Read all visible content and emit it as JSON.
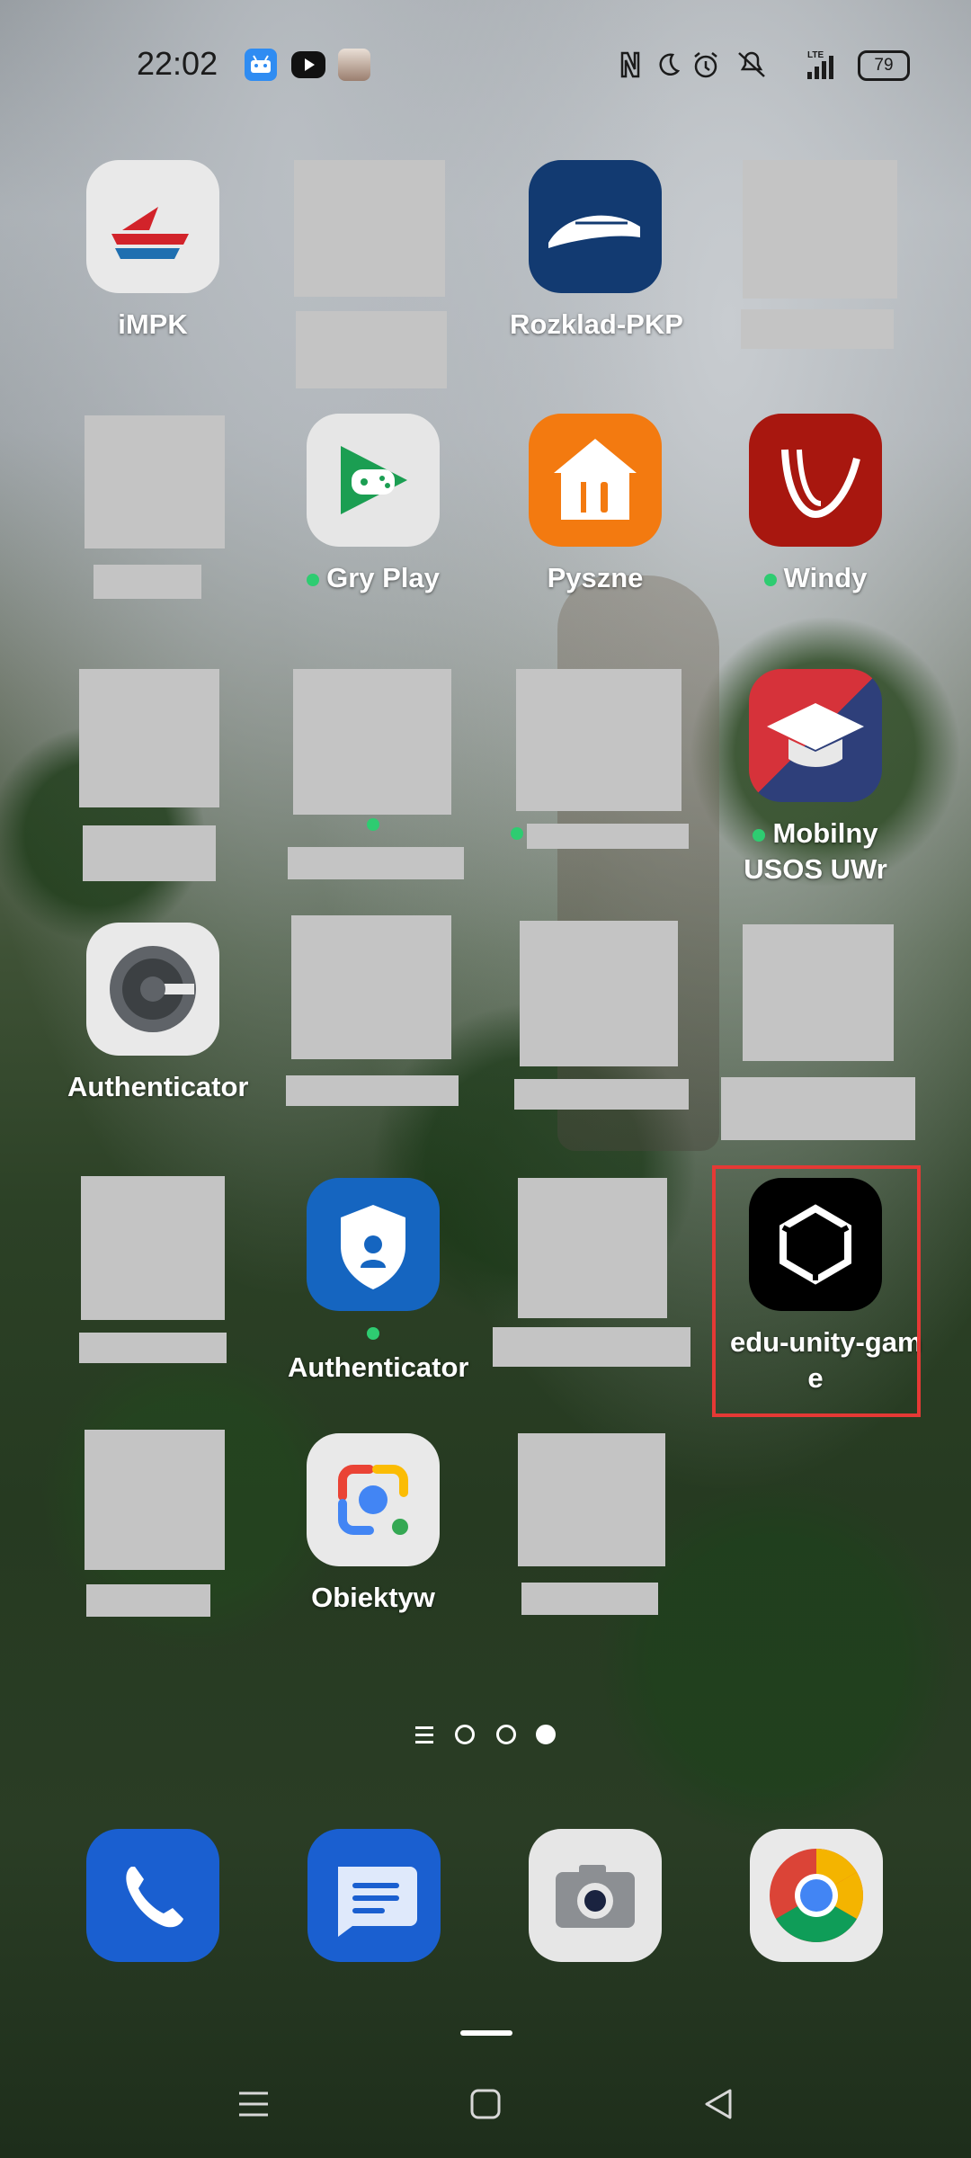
{
  "status_bar": {
    "time": "22:02",
    "notification_icons": [
      "android-icon",
      "youtube-icon",
      "avatar-icon"
    ],
    "system_icons": [
      "nfc-icon",
      "moon-icon",
      "alarm-icon",
      "mute-icon",
      "lte-signal-icon"
    ],
    "battery": "79"
  },
  "apps": {
    "impk": "iMPK",
    "rozklad": "Rozklad-PKP",
    "gry_play": "Gry Play",
    "pyszne": "Pyszne",
    "windy": "Windy",
    "usos_line1": "Mobilny",
    "usos_line2": "USOS UWr",
    "authenticator_google": "Authenticator",
    "authenticator_ms": "Authenticator",
    "unity_line1": "edu-unity-gam",
    "unity_line2": "e",
    "obiektyw": "Obiektyw"
  },
  "dock": [
    "phone-icon",
    "messages-icon",
    "camera-icon",
    "chrome-icon"
  ],
  "pager": {
    "pages": 3,
    "active": 3
  },
  "colors": {
    "highlight": "#e53935",
    "notification_dot": "#2ecc71",
    "redacted": "#c4c4c4"
  }
}
